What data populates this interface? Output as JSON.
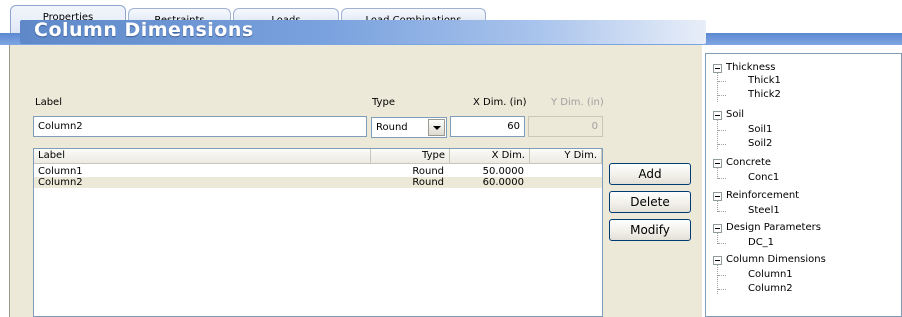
{
  "tabs": [
    {
      "label": "Properties",
      "active": true
    },
    {
      "label": "Restraints",
      "active": false
    },
    {
      "label": "Loads",
      "active": false
    },
    {
      "label": "Load Combinations",
      "active": false
    }
  ],
  "panel": {
    "title": "Column Dimensions",
    "fields": {
      "label_caption": "Label",
      "type_caption": "Type",
      "xdim_caption": "X Dim. (in)",
      "ydim_caption": "Y Dim. (in)",
      "label_value": "Column2",
      "type_value": "Round",
      "xdim_value": "60",
      "ydim_value": "0"
    },
    "list": {
      "columns": [
        "Label",
        "Type",
        "X Dim.",
        "Y Dim."
      ],
      "rows": [
        {
          "label": "Column1",
          "type": "Round",
          "xdim": "50.0000",
          "ydim": ""
        },
        {
          "label": "Column2",
          "type": "Round",
          "xdim": "60.0000",
          "ydim": ""
        }
      ]
    },
    "buttons": {
      "add": "Add",
      "delete": "Delete",
      "modify": "Modify"
    }
  },
  "tree": [
    {
      "label": "Thickness",
      "children": [
        "Thick1",
        "Thick2"
      ]
    },
    {
      "label": "Soil",
      "children": [
        "Soil1",
        "Soil2"
      ]
    },
    {
      "label": "Concrete",
      "children": [
        "Conc1"
      ]
    },
    {
      "label": "Reinforcement",
      "children": [
        "Steel1"
      ]
    },
    {
      "label": "Design Parameters",
      "children": [
        "DC_1"
      ]
    },
    {
      "label": "Column Dimensions",
      "children": [
        "Column1",
        "Column2"
      ]
    }
  ],
  "colors": {
    "accent_band": "#6b95d8",
    "title_text": "#ffffff",
    "panel_bg": "#ece9d8"
  }
}
